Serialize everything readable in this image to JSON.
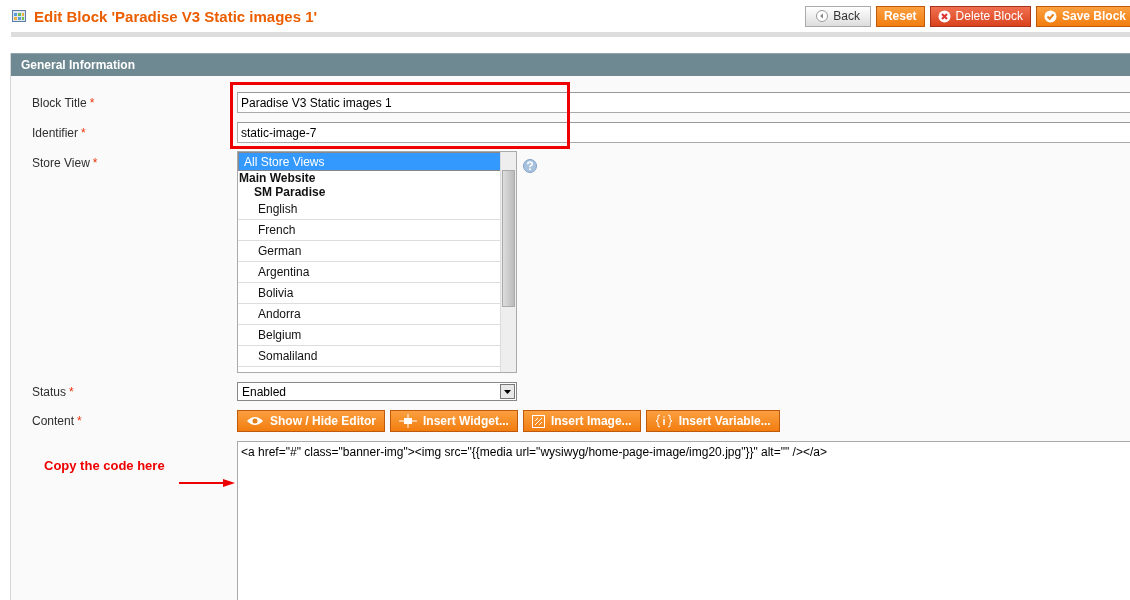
{
  "page_title": "Edit Block 'Paradise V3 Static images 1'",
  "header_buttons": [
    {
      "label": "Back",
      "kind": "back"
    },
    {
      "label": "Reset",
      "kind": "reset"
    },
    {
      "label": "Delete Block",
      "kind": "delete"
    },
    {
      "label": "Save Block",
      "kind": "save"
    }
  ],
  "section_title": "General Information",
  "block_title": {
    "label": "Block Title",
    "required_mark": "*",
    "value": "Paradise V3 Static images 1"
  },
  "identifier": {
    "label": "Identifier",
    "required_mark": "*",
    "value": "static-image-7"
  },
  "store_view": {
    "label": "Store View",
    "required_mark": "*",
    "options": [
      {
        "label": "All Store Views",
        "selected": true
      },
      {
        "label": "Main Website",
        "selected": false,
        "children": [
          {
            "label": "SM Paradise",
            "selected": false,
            "children": [
              {
                "label": "English",
                "selected": false
              },
              {
                "label": "French",
                "selected": false
              },
              {
                "label": "German",
                "selected": false
              },
              {
                "label": "Argentina",
                "selected": false
              },
              {
                "label": "Bolivia",
                "selected": false
              },
              {
                "label": "Andorra",
                "selected": false
              },
              {
                "label": "Belgium",
                "selected": false
              },
              {
                "label": "Somaliland",
                "selected": false
              }
            ]
          }
        ]
      }
    ]
  },
  "status": {
    "label": "Status",
    "required_mark": "*",
    "value": "Enabled"
  },
  "content": {
    "label": "Content",
    "required_mark": "*",
    "editor_buttons": [
      {
        "label": "Show / Hide Editor",
        "kind": "eye"
      },
      {
        "label": "Insert Widget...",
        "kind": "widget"
      },
      {
        "label": "Insert Image...",
        "kind": "image"
      },
      {
        "label": "Insert Variable...",
        "kind": "variable"
      }
    ],
    "value": "<a href=\"#\" class=\"banner-img\"><img src=\"{{media url=\"wysiwyg/home-page-image/img20.jpg\"}}\" alt=\"\" /></a>"
  },
  "annotation": {
    "text": "Copy the code here"
  }
}
